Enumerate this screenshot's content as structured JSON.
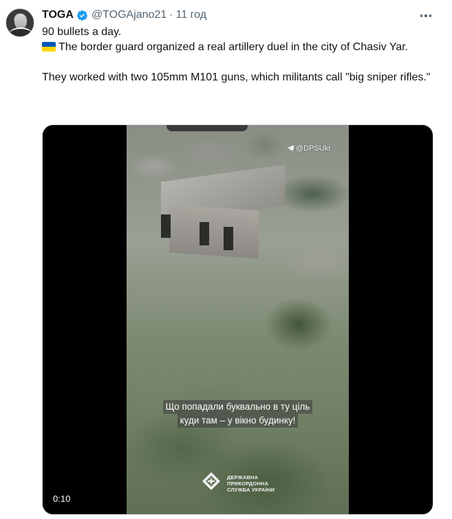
{
  "tweet": {
    "author_name": "TOGA",
    "author_handle": "@TOGAjano21",
    "separator": "·",
    "time": "11 год",
    "text_line1": "90 bullets a day.",
    "text_line2": "The border guard organized a real artillery duel in the city of Chasiv Yar.",
    "text_line3": "They worked with two 105mm M101 guns, which militants call \"big sniper rifles.\""
  },
  "icons": {
    "verified": "verified-badge-icon",
    "more": "more-icon",
    "flag": "ukraine-flag-emoji",
    "telegram": "telegram-icon",
    "logo": "dpsu-emblem-icon"
  },
  "video": {
    "watermark": "@DPSUkr",
    "subtitle_line1": "Що попадали буквально в ту ціль",
    "subtitle_line2": "куди там – у вікно будинку!",
    "logo_line1": "ДЕРЖАВНА",
    "logo_line2": "ПРИКОРДОННА",
    "logo_line3": "СЛУЖБА УКРАЇНИ",
    "duration": "0:10"
  },
  "colors": {
    "verified_blue": "#1d9bf0",
    "secondary_text": "#536471",
    "flag_blue": "#0057b7",
    "flag_yellow": "#ffd700"
  }
}
